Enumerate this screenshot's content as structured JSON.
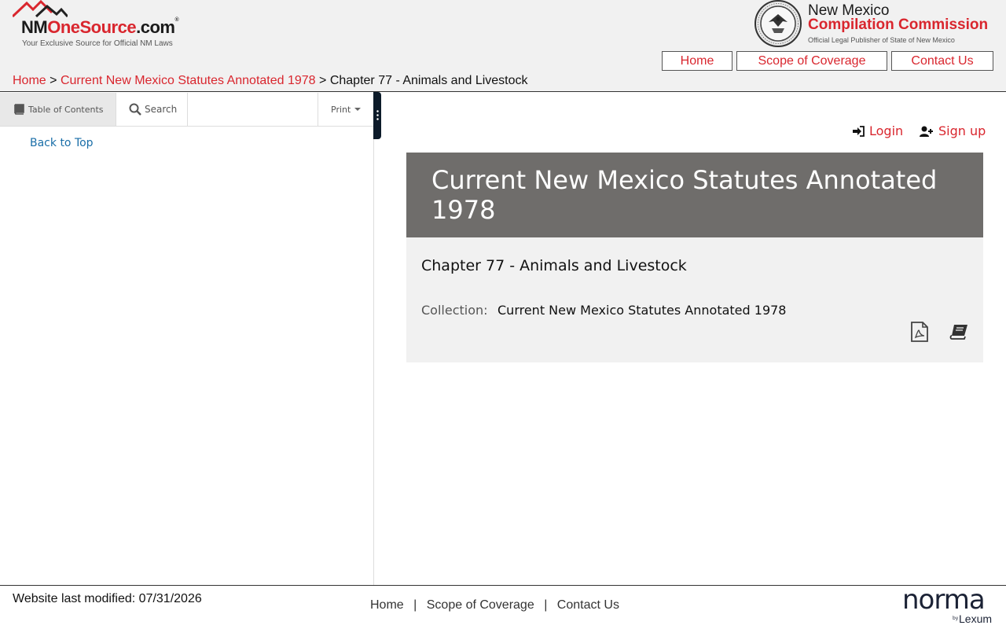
{
  "header": {
    "logo": {
      "nm": "NM",
      "one_source": "OneSource",
      "dotcom": ".com",
      "registered": "®",
      "tagline": "Your Exclusive Source for Official NM Laws"
    },
    "commission": {
      "line1": "New Mexico",
      "line2": "Compilation Commission",
      "subtitle": "Official Legal Publisher of State of New Mexico"
    },
    "nav": {
      "home": "Home",
      "scope": "Scope of Coverage",
      "contact": "Contact Us"
    },
    "breadcrumb": {
      "home": "Home",
      "collection": "Current New Mexico Statutes Annotated 1978",
      "current": "Chapter 77 - Animals and Livestock",
      "separator": ">"
    }
  },
  "sidebar": {
    "tabs": {
      "toc": "Table of Contents",
      "search": "Search",
      "print": "Print"
    },
    "back_to_top": "Back to Top"
  },
  "auth": {
    "login": "Login",
    "signup": "Sign up"
  },
  "document": {
    "title": "Current New Mexico Statutes Annotated 1978",
    "chapter": "Chapter 77 - Animals and Livestock",
    "collection_label": "Collection:",
    "collection_value": "Current New Mexico Statutes Annotated 1978",
    "icons": [
      "pdf-icon",
      "book-icon"
    ]
  },
  "footer": {
    "modified": "Website last modified: 07/31/2026",
    "links": {
      "home": "Home",
      "scope": "Scope of Coverage",
      "contact": "Contact Us",
      "separator": "|"
    },
    "brand": {
      "word": "norma",
      "by": "by",
      "lexum": "Lexum"
    }
  },
  "colors": {
    "accent": "#d9262e",
    "link": "#1a6ea8",
    "doc_header_bg": "#6f6d6b",
    "panel_bg": "#f1f1f1",
    "splitter": "#0d1b2a"
  }
}
